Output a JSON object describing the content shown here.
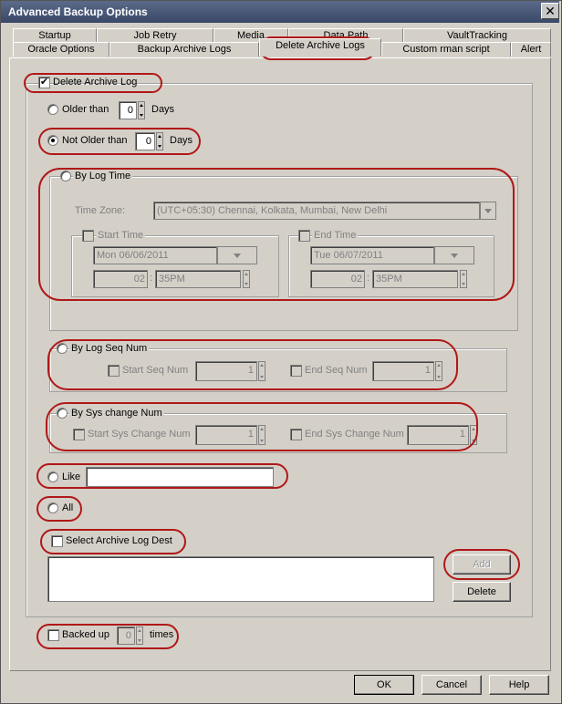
{
  "window": {
    "title": "Advanced Backup Options",
    "close_glyph": "✕"
  },
  "tabs_row1": [
    "Startup",
    "Job Retry",
    "Media",
    "Data Path",
    "VaultTracking"
  ],
  "tabs_row2": [
    "Oracle Options",
    "Backup Archive Logs",
    "Delete Archive Logs",
    "Custom rman script",
    "Alert"
  ],
  "active_tab": "Delete Archive Logs",
  "delete_archive_log": {
    "label": "Delete Archive Log",
    "checked": true
  },
  "older_than": {
    "label": "Older than",
    "value": "0",
    "unit": "Days",
    "selected": false
  },
  "not_older_than": {
    "label": "Not Older than",
    "value": "0",
    "unit": "Days",
    "selected": true
  },
  "by_log_time": {
    "label": "By Log Time",
    "timezone_label": "Time Zone:",
    "timezone_value": "(UTC+05:30) Chennai, Kolkata, Mumbai, New Delhi",
    "start": {
      "label": "Start Time",
      "date": "Mon 06/06/2011",
      "hour": "02",
      "minute": "35",
      "ampm": "PM",
      "sep": ":"
    },
    "end": {
      "label": "End Time",
      "date": "Tue 06/07/2011",
      "hour": "02",
      "minute": "35",
      "ampm": "PM",
      "sep": ":"
    }
  },
  "by_log_seq": {
    "label": "By Log Seq Num",
    "start_label": "Start Seq Num",
    "start_value": "1",
    "end_label": "End Seq Num",
    "end_value": "1"
  },
  "by_sys_change": {
    "label": "By Sys change Num",
    "start_label": "Start Sys Change Num",
    "start_value": "1",
    "end_label": "End Sys Change Num",
    "end_value": "1"
  },
  "like": {
    "label": "Like",
    "value": ""
  },
  "all": {
    "label": "All"
  },
  "select_dest": {
    "label": "Select Archive Log Dest",
    "checked": false
  },
  "dest_buttons": {
    "add": "Add",
    "delete": "Delete"
  },
  "backed_up": {
    "label": "Backed up",
    "value": "0",
    "unit": "times",
    "checked": false
  },
  "footer": {
    "ok": "OK",
    "cancel": "Cancel",
    "help": "Help"
  },
  "colors": {
    "callout": "#b01818",
    "titlebar": "#3a4868",
    "face": "#d4d0c8"
  }
}
